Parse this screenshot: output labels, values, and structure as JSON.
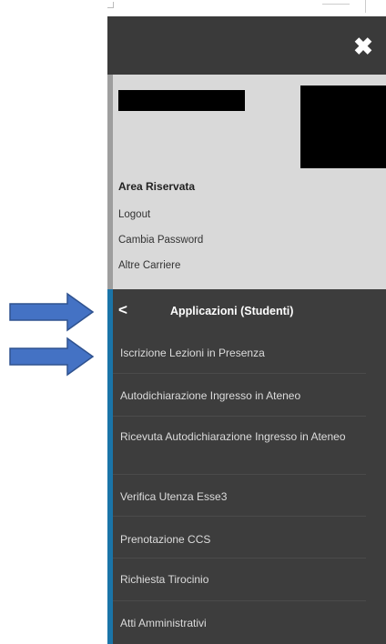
{
  "header": {
    "close_icon": "close-x-icon"
  },
  "user_area": {
    "section_title": "Area Riservata",
    "links": [
      "Logout",
      "Cambia Password",
      "Altre Carriere"
    ]
  },
  "apps_menu": {
    "back_icon": "chevron-left-icon",
    "title": "Applicazioni (Studenti)",
    "items": [
      "Iscrizione Lezioni in Presenza",
      "Autodichiarazione Ingresso in Ateneo",
      "Ricevuta Autodichiarazione Ingresso in Ateneo",
      "Verifica Utenza Esse3",
      "Prenotazione CCS",
      "Richiesta Tirocinio",
      "Atti Amministrativi"
    ]
  },
  "colors": {
    "header_bg": "#3a3a3a",
    "user_bg": "#d9d9d9",
    "menu_bg": "#3d3d3d",
    "accent": "#1a74a8",
    "arrow": "#4472c4"
  }
}
